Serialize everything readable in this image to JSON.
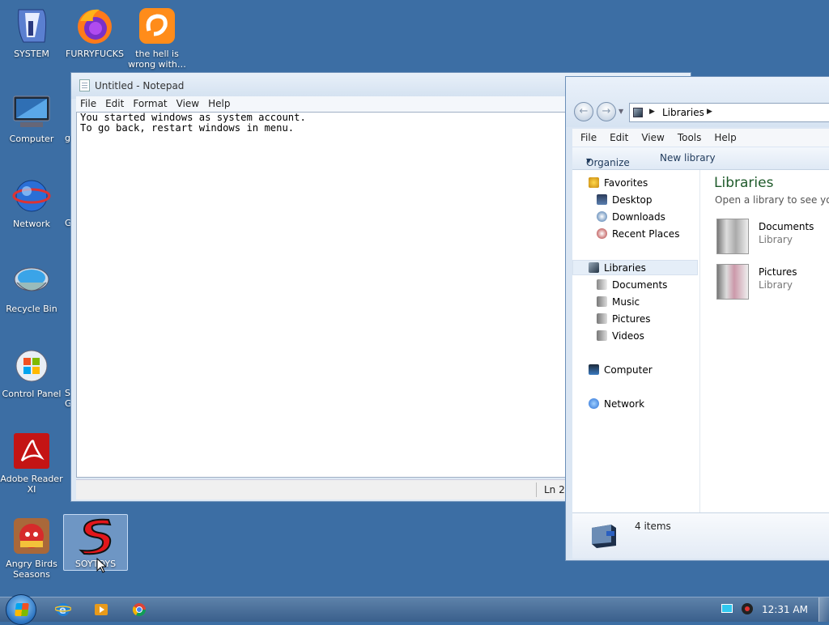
{
  "desktop": {
    "icons": [
      {
        "label": "SYSTEM"
      },
      {
        "label": "FURRYFUCKS"
      },
      {
        "label": "the hell is wrong with…"
      },
      {
        "label": "Computer"
      },
      {
        "label": "Network"
      },
      {
        "label": "Recycle Bin"
      },
      {
        "label": "Control Panel"
      },
      {
        "label": "Adobe Reader XI"
      },
      {
        "label": "Angry Birds Seasons"
      },
      {
        "label": "SOYTOYS"
      }
    ],
    "partial_labels": [
      "g",
      "G",
      "S",
      "G"
    ]
  },
  "notepad": {
    "title": "Untitled - Notepad",
    "menu": [
      "File",
      "Edit",
      "Format",
      "View",
      "Help"
    ],
    "content": "You started windows as system account.\nTo go back, restart windows in menu.",
    "status": "Ln 2,"
  },
  "explorer": {
    "address": "Libraries",
    "menu": [
      "File",
      "Edit",
      "View",
      "Tools",
      "Help"
    ],
    "toolbar": {
      "organize": "Organize",
      "new_library": "New library"
    },
    "tree": {
      "favorites": "Favorites",
      "desktop": "Desktop",
      "downloads": "Downloads",
      "recent": "Recent Places",
      "libraries": "Libraries",
      "documents": "Documents",
      "music": "Music",
      "pictures": "Pictures",
      "videos": "Videos",
      "computer": "Computer",
      "network": "Network"
    },
    "content": {
      "title": "Libraries",
      "subtitle": "Open a library to see your f",
      "items": [
        {
          "name": "Documents",
          "type": "Library"
        },
        {
          "name": "Pictures",
          "type": "Library"
        }
      ]
    },
    "details": {
      "count": "4 items"
    }
  },
  "taskbar": {
    "clock": "12:31 AM",
    "pinned": [
      "internet-explorer-icon",
      "media-player-icon",
      "chrome-icon"
    ]
  }
}
